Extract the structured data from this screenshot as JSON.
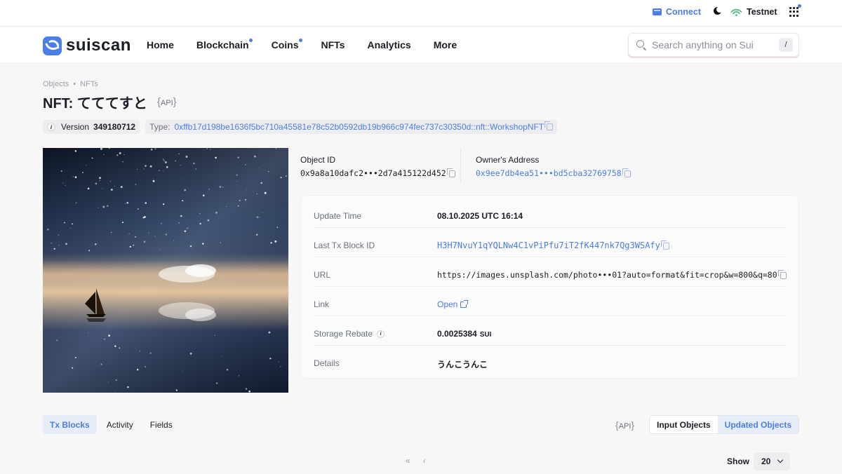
{
  "utilbar": {
    "connect_label": "Connect",
    "network_label": "Testnet"
  },
  "nav": {
    "logo_text": "suiscan",
    "items": [
      {
        "label": "Home",
        "dot": false
      },
      {
        "label": "Blockchain",
        "dot": true
      },
      {
        "label": "Coins",
        "dot": true
      },
      {
        "label": "NFTs",
        "dot": false
      },
      {
        "label": "Analytics",
        "dot": false
      },
      {
        "label": "More",
        "dot": false
      }
    ],
    "search_placeholder": "Search anything on Sui",
    "search_shortcut": "/"
  },
  "breadcrumb": {
    "items": [
      "Objects",
      "NFTs"
    ],
    "separator": "•"
  },
  "header": {
    "title": "NFT: てててすと",
    "api_label": "API",
    "version_label": "Version",
    "version_value": "349180712",
    "type_label": "Type:",
    "type_value": "0xffb17d198be1636f5bc710a45581e78c52b0592db19b966c974fec737c30350d::nft::WorkshopNFT"
  },
  "object": {
    "object_id_label": "Object ID",
    "object_id_value": "0x9a8a10dafc2•••2d7a415122d452",
    "owner_label": "Owner's Address",
    "owner_value": "0x9ee7db4ea51•••bd5cba32769758"
  },
  "details": [
    {
      "key": "Update Time",
      "value": "08.10.2025 UTC 16:14",
      "style": "bold"
    },
    {
      "key": "Last Tx Block ID",
      "value": "H3H7NvuY1qYQLNw4C1vPiPfu7iT2fK447nk7Qg3WSAfy",
      "style": "link-mono"
    },
    {
      "key": "URL",
      "value": "https://images.unsplash.com/photo•••01?auto=format&fit=crop&w=800&q=80",
      "style": "mono"
    },
    {
      "key": "Link",
      "value": "Open",
      "style": "link"
    },
    {
      "key": "Storage Rebate",
      "value": "0.0025384",
      "unit": "SUI",
      "style": "bold"
    },
    {
      "key": "Details",
      "value": "うんこうんこ",
      "style": "bold"
    }
  ],
  "tabs": [
    "Tx Blocks",
    "Activity",
    "Fields"
  ],
  "active_tab": "Tx Blocks",
  "api2_label": "API",
  "segment": {
    "options": [
      "Input Objects",
      "Updated Objects"
    ],
    "active": "Updated Objects"
  },
  "pager": {
    "first": "«",
    "prev": "‹"
  },
  "show": {
    "label": "Show",
    "value": "20"
  },
  "colors": {
    "accent": "#4a7de0",
    "logo": "#4b7ee8"
  }
}
